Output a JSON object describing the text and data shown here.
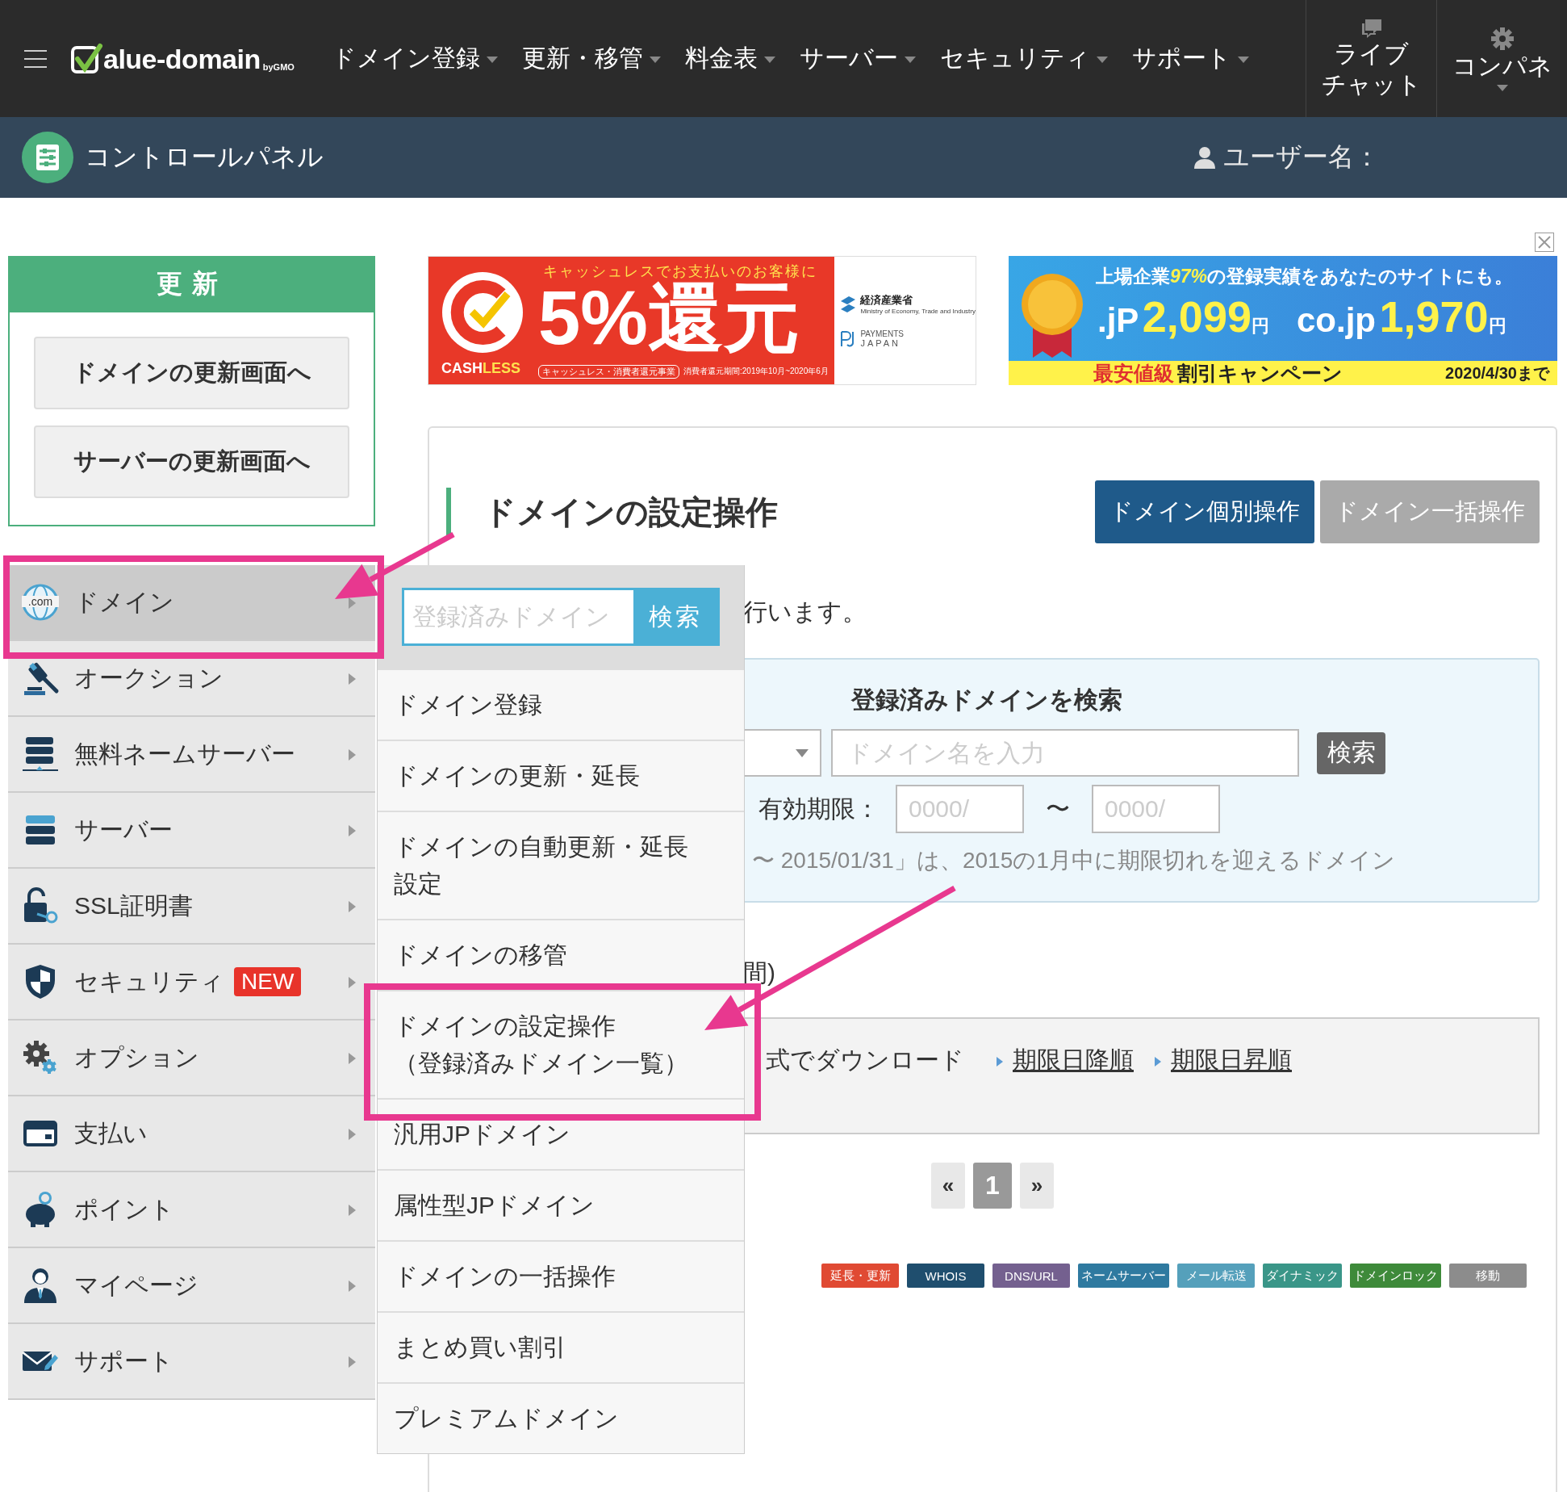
{
  "header": {
    "logo": {
      "text": "alue-domain",
      "suffix": "byGMO"
    },
    "nav": [
      {
        "label": "ドメイン登録"
      },
      {
        "label": "更新・移管"
      },
      {
        "label": "料金表"
      },
      {
        "label": "サーバー"
      },
      {
        "label": "セキュリティ"
      },
      {
        "label": "サポート"
      }
    ],
    "live_chat": {
      "lines": [
        "ライブ",
        "チャット"
      ]
    },
    "control_panel_menu": {
      "label": "コンパネ"
    }
  },
  "subheader": {
    "title": "コントロールパネル",
    "user_label": "ユーザー名："
  },
  "renew_box": {
    "title": "更新",
    "buttons": [
      "ドメインの更新画面へ",
      "サーバーの更新画面へ"
    ]
  },
  "sidebar": {
    "items": [
      {
        "label": "ドメイン",
        "icon_text": ".com",
        "selected": true
      },
      {
        "label": "オークション",
        "selected": false
      },
      {
        "label": "無料ネームサーバー",
        "selected": false
      },
      {
        "label": "サーバー",
        "selected": false
      },
      {
        "label": "SSL証明書",
        "selected": false
      },
      {
        "label": "セキュリティ",
        "badge": "NEW",
        "selected": false
      },
      {
        "label": "オプション",
        "selected": false
      },
      {
        "label": "支払い",
        "selected": false
      },
      {
        "label": "ポイント",
        "selected": false
      },
      {
        "label": "マイページ",
        "selected": false
      },
      {
        "label": "サポート",
        "selected": false
      }
    ]
  },
  "submenu": {
    "search": {
      "placeholder": "登録済みドメイン",
      "button": "検索"
    },
    "items": [
      {
        "lines": [
          "ドメイン登録"
        ]
      },
      {
        "lines": [
          "ドメインの更新・延長"
        ]
      },
      {
        "lines": [
          "ドメインの自動更新・延長",
          "設定"
        ]
      },
      {
        "lines": [
          "ドメインの移管"
        ]
      },
      {
        "lines": [
          "ドメインの設定操作",
          "（登録済みドメイン一覧）"
        ]
      },
      {
        "lines": [
          "汎用JPドメイン"
        ]
      },
      {
        "lines": [
          "属性型JPドメイン"
        ]
      },
      {
        "lines": [
          "ドメインの一括操作"
        ]
      },
      {
        "lines": [
          "まとめ買い割引"
        ]
      },
      {
        "lines": [
          "プレミアムドメイン"
        ]
      }
    ]
  },
  "banners": {
    "cashless": {
      "headline": "キャッシュレスでお支払いのお客様に",
      "big": "5%還元",
      "brand": [
        "CASH",
        "LESS"
      ],
      "program": "キャッシュレス・消費者還元事業",
      "period": "消費者還元期間:2019年10月~2020年6月",
      "ministry": "経済産業省",
      "ministry_en": "Ministry of Economy, Trade and Industry",
      "payments": "PAYMENTS",
      "japan": "JAPAN"
    },
    "campaign": {
      "headline": [
        "上場企業",
        "97%",
        "の登録実績をあなたのサイトにも。"
      ],
      "prices": [
        {
          "tld": ".jP",
          "price": "2,099",
          "unit": "円"
        },
        {
          "tld": "co.jp",
          "price": "1,970",
          "unit": "円"
        }
      ],
      "tag": "最安値級",
      "campaign": "割引キャンペーン",
      "deadline": "2020/4/30まで"
    }
  },
  "main": {
    "title": "ドメインの設定操作",
    "tabs": [
      {
        "label": "ドメイン個別操作",
        "selected": true
      },
      {
        "label": "ドメイン一括操作",
        "selected": false
      }
    ],
    "intro": "行います。",
    "search_panel": {
      "title": "登録済みドメインを検索",
      "input_placeholder": "ドメイン名を入力",
      "button": "検索",
      "expiry_label": "有効期限：",
      "date_from_placeholder": "0000/",
      "range_sep": "〜",
      "date_to_placeholder": "0000/",
      "note": "〜 2015/01/31」は、2015の1月中に期限切れを迎えるドメイン"
    },
    "fragment": "間)",
    "download": {
      "text": "式でダウンロード",
      "links": [
        "期限日降順",
        "期限日昇順"
      ]
    },
    "pagination": {
      "prev": "«",
      "pages": [
        {
          "label": "1",
          "selected": true
        }
      ],
      "next": "»"
    },
    "legend": [
      {
        "label": "延長・更新",
        "color": "#e04a33"
      },
      {
        "label": "WHOIS",
        "color": "#1f4e6e"
      },
      {
        "label": "DNS/URL",
        "color": "#74608f"
      },
      {
        "label": "ネームサーバー",
        "color": "#2f7aa0"
      },
      {
        "label": "メール転送",
        "color": "#55a0bb"
      },
      {
        "label": "ダイナミック",
        "color": "#3a9688"
      },
      {
        "label": "ドメインロック",
        "color": "#3e8a3a"
      },
      {
        "label": "移動",
        "color": "#8c8c8c"
      }
    ]
  }
}
